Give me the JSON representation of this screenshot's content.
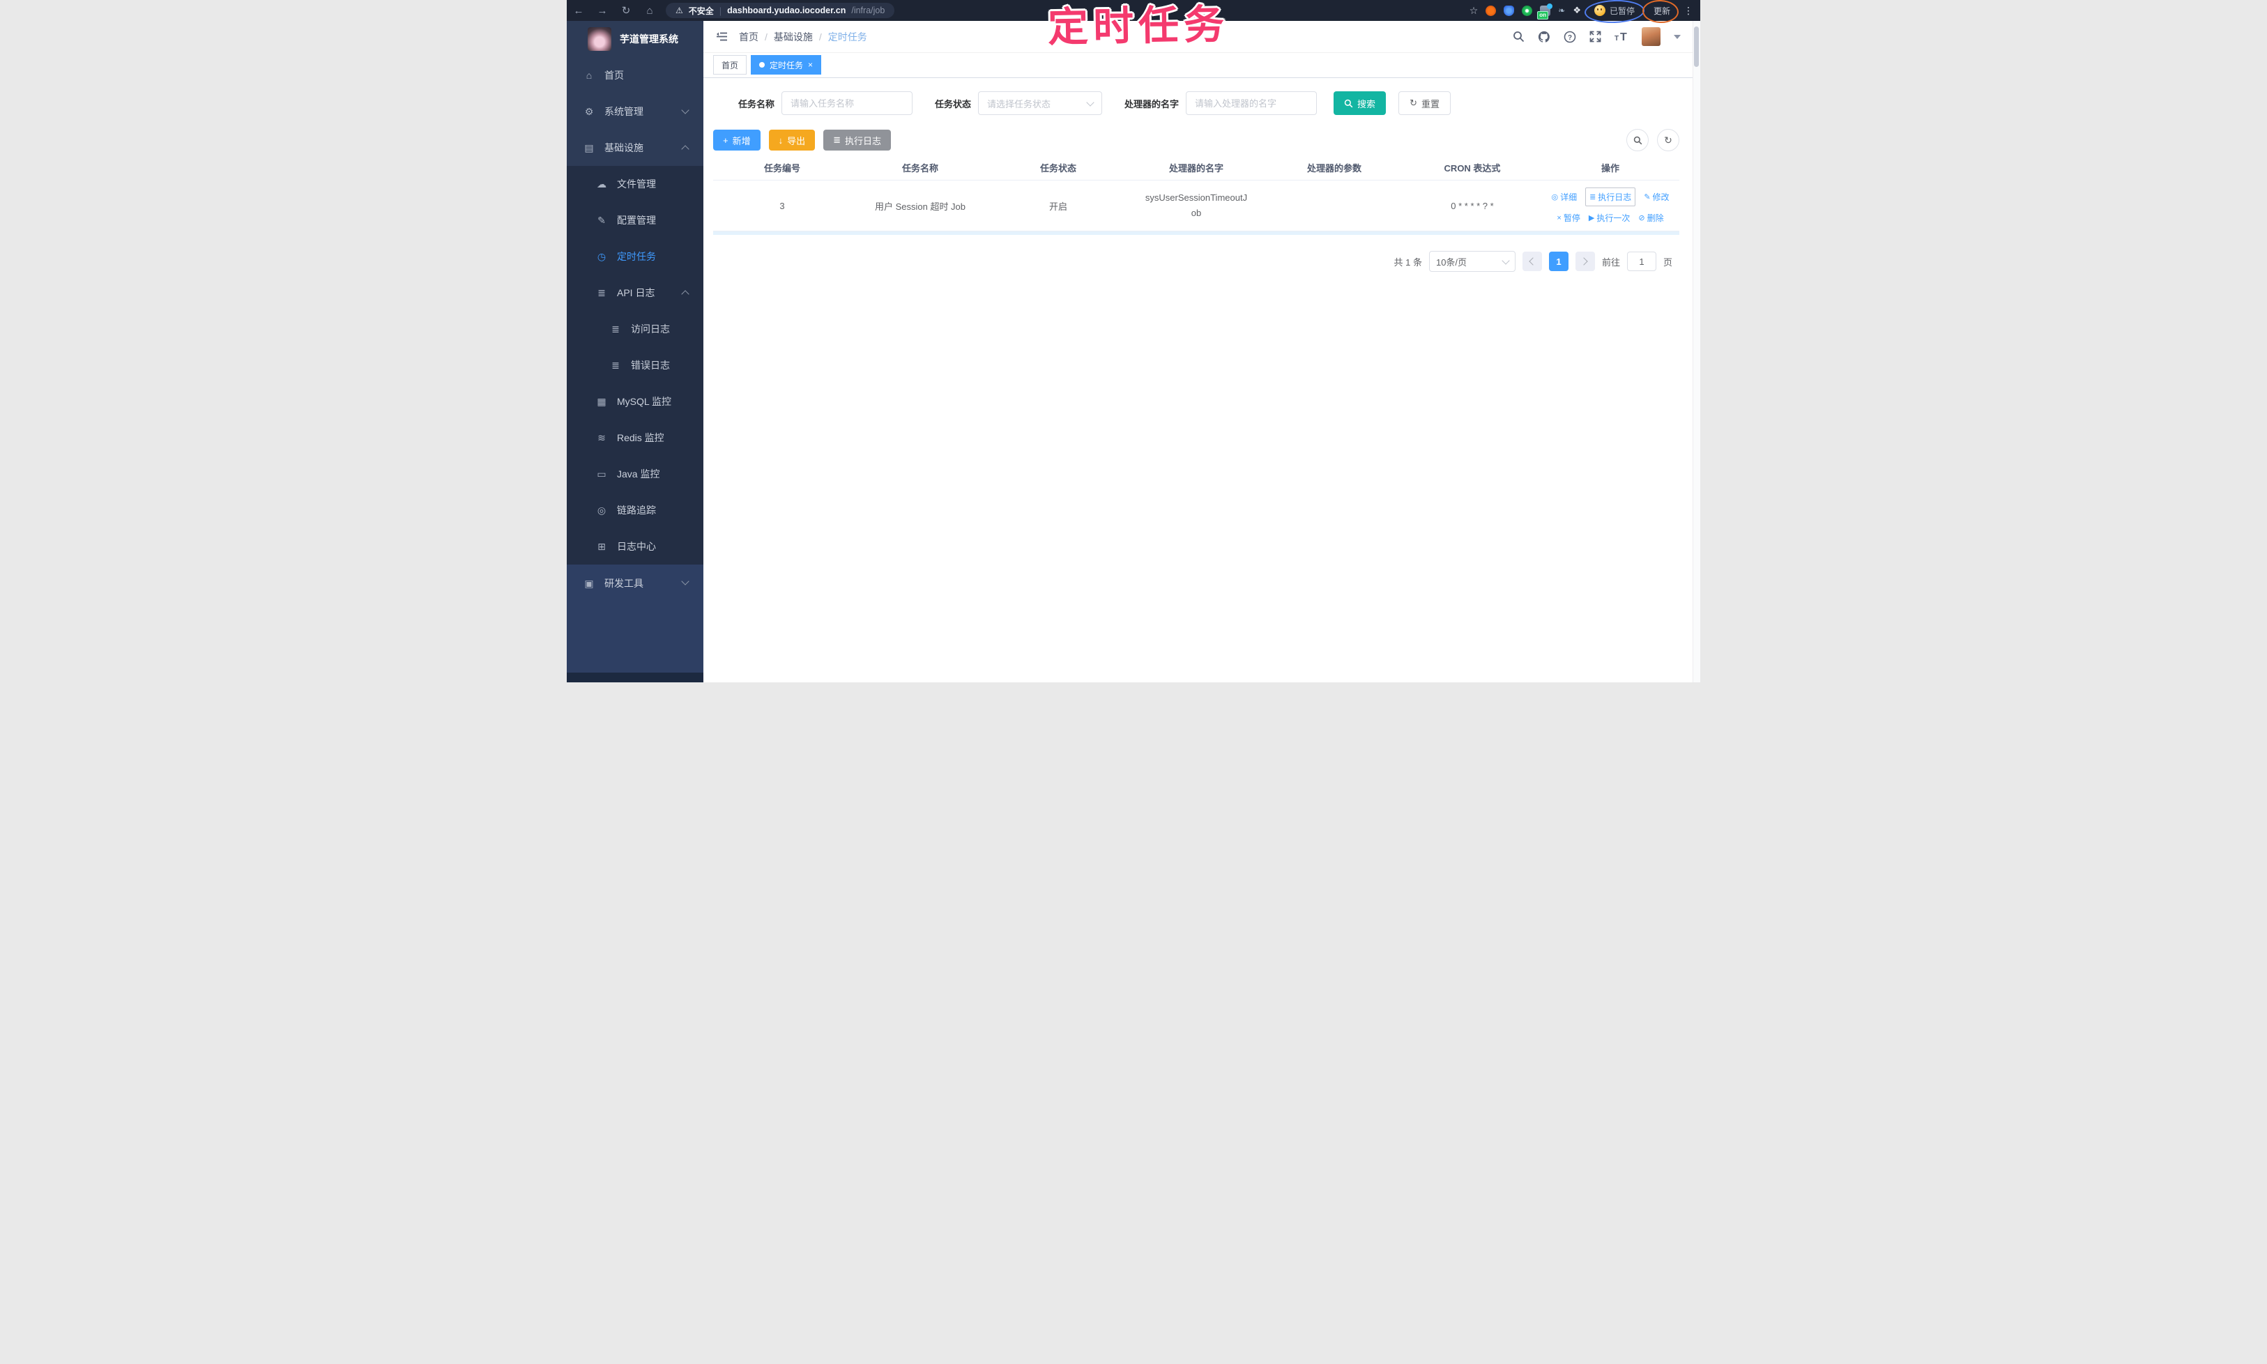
{
  "browser": {
    "security_label": "不安全",
    "url_host": "dashboard.yudao.iocoder.cn",
    "url_path": "/infra/job",
    "paused_badge": "已暂停",
    "update_button": "更新",
    "on_badge": "on"
  },
  "annotation": {
    "title": "定时任务"
  },
  "sidebar": {
    "app_title": "芋道管理系统",
    "items": [
      {
        "label": "首页",
        "icon": "home-icon"
      },
      {
        "label": "系统管理",
        "icon": "gear-icon"
      },
      {
        "label": "基础设施",
        "icon": "infra-icon"
      },
      {
        "label": "文件管理",
        "icon": "cloud-upload-icon"
      },
      {
        "label": "配置管理",
        "icon": "edit-icon"
      },
      {
        "label": "定时任务",
        "icon": "timer-icon"
      },
      {
        "label": "API 日志",
        "icon": "api-log-icon"
      },
      {
        "label": "访问日志",
        "icon": "access-log-icon"
      },
      {
        "label": "错误日志",
        "icon": "error-log-icon"
      },
      {
        "label": "MySQL 监控",
        "icon": "mysql-monitor-icon"
      },
      {
        "label": "Redis 监控",
        "icon": "redis-monitor-icon"
      },
      {
        "label": "Java 监控",
        "icon": "java-monitor-icon"
      },
      {
        "label": "链路追踪",
        "icon": "trace-icon"
      },
      {
        "label": "日志中心",
        "icon": "log-center-icon"
      },
      {
        "label": "研发工具",
        "icon": "devtools-icon"
      }
    ]
  },
  "header": {
    "breadcrumb": [
      "首页",
      "基础设施",
      "定时任务"
    ]
  },
  "tabs": [
    {
      "label": "首页"
    },
    {
      "label": "定时任务"
    }
  ],
  "filters": {
    "name_label": "任务名称",
    "name_placeholder": "请输入任务名称",
    "status_label": "任务状态",
    "status_placeholder": "请选择任务状态",
    "handler_label": "处理器的名字",
    "handler_placeholder": "请输入处理器的名字",
    "search_button": "搜索",
    "reset_button": "重置"
  },
  "toolbar": {
    "add_button": "新增",
    "export_button": "导出",
    "exec_log_button": "执行日志"
  },
  "table": {
    "headers": [
      "任务编号",
      "任务名称",
      "任务状态",
      "处理器的名字",
      "处理器的参数",
      "CRON 表达式",
      "操作"
    ],
    "rows": [
      {
        "id": "3",
        "name": "用户 Session 超时 Job",
        "status": "开启",
        "handler": "sysUserSessionTimeoutJob",
        "params": "",
        "cron": "0 * * * * ? *"
      }
    ],
    "row_actions": [
      "详细",
      "执行日志",
      "修改",
      "暂停",
      "执行一次",
      "删除"
    ]
  },
  "pagination": {
    "total": "共 1 条",
    "page_size": "10条/页",
    "current_page": "1",
    "goto_label": "前往",
    "goto_value": "1",
    "goto_unit": "页"
  },
  "icons": {
    "back": "←",
    "forward": "→",
    "reload": "↻",
    "home": "⌂",
    "warning": "⚠",
    "star": "☆",
    "leaf": "❧",
    "puzzle": "❖",
    "menu_dots": "⋮",
    "home_menu": "⌂",
    "gear": "⚙",
    "infra": "▤",
    "cloud": "☁",
    "edit": "✎",
    "timer": "◷",
    "api_log": "≣",
    "access_log": "≣",
    "error_log": "≣",
    "mysql": "▦",
    "redis": "≋",
    "java": "▭",
    "trace": "◎",
    "log_center": "⊞",
    "devtools": "▣",
    "plus": "+",
    "download": "↓",
    "list": "≣",
    "refresh": "↻",
    "detail": "◎",
    "modify": "✎",
    "pause": "×",
    "run_once": "▶",
    "delete": "⊘",
    "tab_close": "×"
  },
  "colors": {
    "accent_blue": "#409eff",
    "search_teal": "#13b5a2",
    "export_orange": "#f5a81f",
    "gray_button": "#909399",
    "annotation_pink": "#f43a6e",
    "sidebar_bg": "#2d3b56"
  }
}
